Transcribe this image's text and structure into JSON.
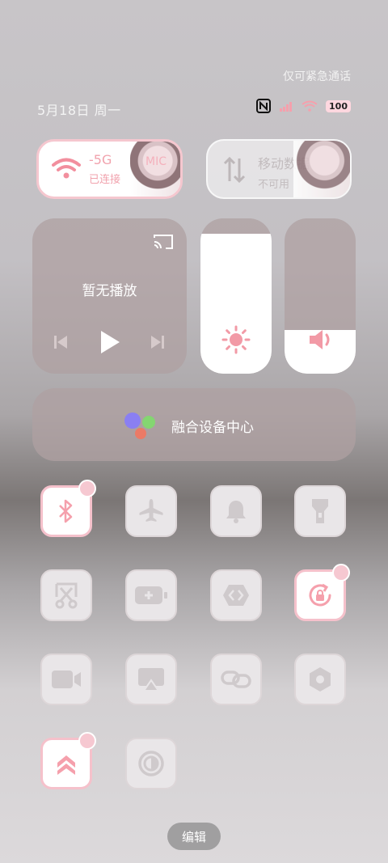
{
  "status_bar": {
    "emergency_text": "仅可紧急通话",
    "date_text": "5月18日 周一",
    "battery_level": "100",
    "icons": [
      "nfc-icon",
      "signal-icon",
      "wifi-icon",
      "battery-icon"
    ]
  },
  "connectivity": {
    "wifi": {
      "title": "-5G",
      "suffix": "MIC",
      "status": "已连接",
      "active": true
    },
    "mobile_data": {
      "title": "移动数据",
      "status": "不可用",
      "active": false
    }
  },
  "media": {
    "title": "暂无播放"
  },
  "sliders": {
    "brightness_level": 0.9,
    "volume_level": 0.28
  },
  "fusion": {
    "label": "融合设备中心"
  },
  "toggles": [
    {
      "name": "bluetooth",
      "icon": "bluetooth-icon",
      "active": true,
      "badge": true
    },
    {
      "name": "airplane-mode",
      "icon": "airplane-icon",
      "active": false
    },
    {
      "name": "ring-mode",
      "icon": "bell-icon",
      "active": false
    },
    {
      "name": "flashlight",
      "icon": "flashlight-icon",
      "active": false
    },
    {
      "name": "screenshot",
      "icon": "scissors-icon",
      "active": false
    },
    {
      "name": "battery-saver",
      "icon": "battery-plus-icon",
      "active": false
    },
    {
      "name": "nearby-share",
      "icon": "share-icon",
      "active": false
    },
    {
      "name": "rotation-lock",
      "icon": "rotation-lock-icon",
      "active": true,
      "badge": true
    },
    {
      "name": "screen-record",
      "icon": "video-icon",
      "active": false
    },
    {
      "name": "cast",
      "icon": "cast-screen-icon",
      "active": false
    },
    {
      "name": "hotspot",
      "icon": "link-icon",
      "active": false
    },
    {
      "name": "eye-comfort",
      "icon": "hexagon-icon",
      "active": false
    },
    {
      "name": "performance-mode",
      "icon": "chevrons-up-icon",
      "active": true,
      "badge": true
    },
    {
      "name": "dark-mode",
      "icon": "contrast-icon",
      "active": false
    }
  ],
  "footer": {
    "edit_label": "编辑"
  },
  "colors": {
    "accent": "#f5a0ac",
    "icon_off": "#cfcacc"
  }
}
